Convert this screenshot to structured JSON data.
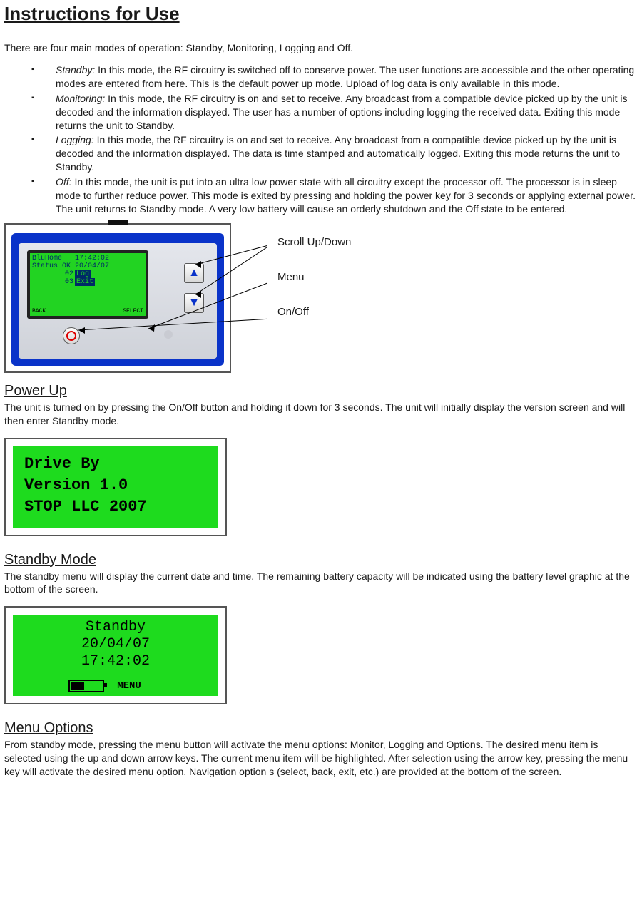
{
  "title": "Instructions for Use",
  "intro": "There are four main modes of operation: Standby, Monitoring, Logging and Off.",
  "modes": [
    {
      "name": "Standby:",
      "text": "  In this mode, the RF circuitry is switched off to conserve power.  The user functions are accessible and the other operating modes are entered from here.  This is the default power up mode.  Upload of log data is only available in this mode."
    },
    {
      "name": "Monitoring:",
      "text": "  In this mode, the RF circuitry is on and set to receive.  Any broadcast from a compatible device picked up by the unit is decoded and the information displayed.  The user has a number of options including logging the received data.  Exiting this mode returns the unit to Standby."
    },
    {
      "name": "Logging:",
      "text": "  In this mode, the RF circuitry is on and set to receive.  Any broadcast from a compatible device picked up by the unit is decoded and the information displayed.  The data is time stamped and automatically logged.  Exiting this mode returns the unit to Standby."
    },
    {
      "name": "Off:",
      "text": "  In this mode, the unit is put into an ultra low power state with all circuitry except the processor off.  The processor is in sleep mode to further reduce power.  This mode is exited by pressing and holding the power key for 3 seconds or applying external power.  The unit returns to Standby mode.  A very low battery will cause an orderly shutdown and the Off state to be entered."
    }
  ],
  "diagram": {
    "lcd": {
      "row1_left": "BluHome",
      "row1_right": "17:42:02",
      "row2_left": "Status OK",
      "row2_right": "20/04/07",
      "list1": "02",
      "list2": "03",
      "hl1": "Log",
      "hl2": "Exit",
      "back": "BACK",
      "select": "SELECT"
    },
    "labels": {
      "scroll": "Scroll Up/Down",
      "menu": "Menu",
      "onoff": "On/Off"
    }
  },
  "power_up": {
    "heading": "Power Up",
    "text": "The unit is turned on by pressing the On/Off button and holding it down for 3 seconds.  The unit will initially display the version screen and will then enter Standby mode.",
    "screen": {
      "l1": "Drive By",
      "l2": "Version 1.0",
      "l3": "STOP LLC 2007"
    }
  },
  "standby": {
    "heading": "Standby Mode",
    "text": "The standby menu will display the current date and time.  The remaining battery capacity will be indicated using the battery level graphic at the bottom of the screen.",
    "screen": {
      "l1": "Standby",
      "l2": "20/04/07",
      "l3": "17:42:02",
      "menu": "MENU"
    }
  },
  "menu_options": {
    "heading": "Menu Options",
    "text": "From standby mode, pressing the menu button will activate the menu options: Monitor, Logging and Options.  The desired menu item is selected using the up and down arrow keys.  The current menu item will be highlighted.  After selection using the arrow key, pressing the menu key will activate the desired menu option.  Navigation option s (select, back, exit, etc.) are provided at the bottom of the screen."
  }
}
